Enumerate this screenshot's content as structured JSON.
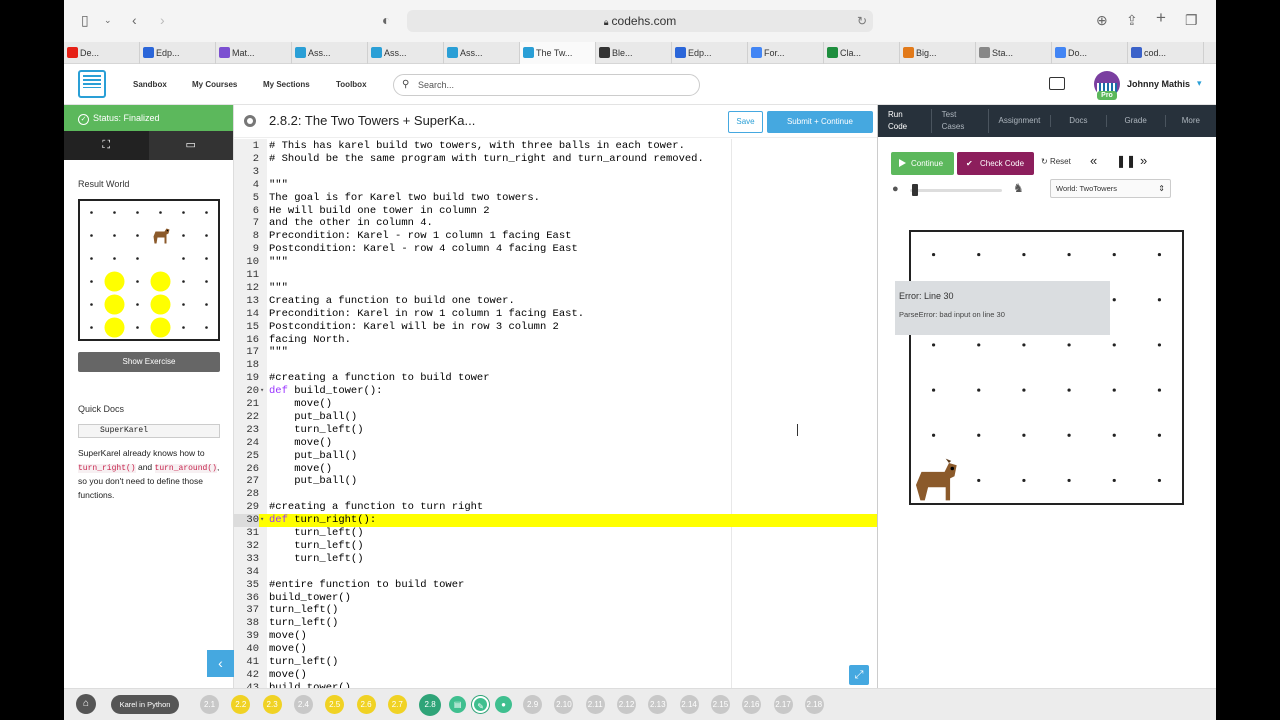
{
  "browser": {
    "url": "codehs.com",
    "tabs": [
      {
        "label": "De...",
        "color": "#e62117"
      },
      {
        "label": "Edp...",
        "color": "#2b66d9"
      },
      {
        "label": "Mat...",
        "color": "#7b4fd1"
      },
      {
        "label": "Ass...",
        "color": "#2a9fd6"
      },
      {
        "label": "Ass...",
        "color": "#2a9fd6"
      },
      {
        "label": "Ass...",
        "color": "#2a9fd6"
      },
      {
        "label": "The Tw...",
        "color": "#2a9fd6"
      },
      {
        "label": "Ble...",
        "color": "#333333"
      },
      {
        "label": "Edp...",
        "color": "#2b66d9"
      },
      {
        "label": "For...",
        "color": "#4285f4"
      },
      {
        "label": "Cla...",
        "color": "#1e8e3e"
      },
      {
        "label": "Big...",
        "color": "#e27a1a"
      },
      {
        "label": "Sta...",
        "color": "#888888"
      },
      {
        "label": "Do...",
        "color": "#4285f4"
      },
      {
        "label": "cod...",
        "color": "#3b62c9"
      }
    ],
    "active_tab": 6
  },
  "header": {
    "nav": [
      "Sandbox",
      "My Courses",
      "My Sections",
      "Toolbox"
    ],
    "search_placeholder": "Search...",
    "user_name": "Johnny Mathis",
    "badge": "Pro"
  },
  "sidebar": {
    "status": "Status: Finalized",
    "result_world_label": "Result World",
    "show_exercise": "Show Exercise",
    "quick_docs_label": "Quick Docs",
    "quick_docs_select": "SuperKarel",
    "quick_docs_text_1": "SuperKarel already knows how to ",
    "quick_docs_code_1": "turn_right()",
    "quick_docs_text_2": " and ",
    "quick_docs_code_2": "turn_around()",
    "quick_docs_text_3": ", so you don't need to define those functions."
  },
  "editor": {
    "title": "2.8.2: The Two Towers + SuperKa...",
    "save_label": "Save",
    "submit_label": "Submit + Continue",
    "highlight_line": 30,
    "lines": [
      {
        "n": "1",
        "t": "# This has karel build two towers, with three balls in each tower.",
        "c": "cm"
      },
      {
        "n": "2",
        "t": "# Should be the same program with turn_right and turn_around removed.",
        "c": "cm"
      },
      {
        "n": "3",
        "t": "",
        "c": ""
      },
      {
        "n": "4",
        "t": "\"\"\"",
        "c": "st"
      },
      {
        "n": "5",
        "t": "The goal is for Karel two build two towers.",
        "c": "st"
      },
      {
        "n": "6",
        "t": "He will build one tower in column 2",
        "c": "st"
      },
      {
        "n": "7",
        "t": "and the other in column 4.",
        "c": "st"
      },
      {
        "n": "8",
        "t": "Precondition: Karel - row 1 column 1 facing East",
        "c": "st"
      },
      {
        "n": "9",
        "t": "Postcondition: Karel - row 4 column 4 facing East",
        "c": "st"
      },
      {
        "n": "10",
        "t": "\"\"\"",
        "c": "st"
      },
      {
        "n": "11",
        "t": "",
        "c": ""
      },
      {
        "n": "12",
        "t": "\"\"\"",
        "c": "st"
      },
      {
        "n": "13",
        "t": "Creating a function to build one tower.",
        "c": "st"
      },
      {
        "n": "14",
        "t": "Precondition: Karel in row 1 column 1 facing East.",
        "c": "st"
      },
      {
        "n": "15",
        "t": "Postcondition: Karel will be in row 3 column 2",
        "c": "st"
      },
      {
        "n": "16",
        "t": "facing North.",
        "c": "st"
      },
      {
        "n": "17",
        "t": "\"\"\"",
        "c": "st"
      },
      {
        "n": "18",
        "t": "",
        "c": ""
      },
      {
        "n": "19",
        "t": "#creating a function to build tower",
        "c": "cm"
      },
      {
        "n": "20",
        "t": "def build_tower():",
        "c": "def"
      },
      {
        "n": "21",
        "t": "    move()",
        "c": ""
      },
      {
        "n": "22",
        "t": "    put_ball()",
        "c": ""
      },
      {
        "n": "23",
        "t": "    turn_left()",
        "c": ""
      },
      {
        "n": "24",
        "t": "    move()",
        "c": ""
      },
      {
        "n": "25",
        "t": "    put_ball()",
        "c": ""
      },
      {
        "n": "26",
        "t": "    move()",
        "c": ""
      },
      {
        "n": "27",
        "t": "    put_ball()",
        "c": ""
      },
      {
        "n": "28",
        "t": "",
        "c": ""
      },
      {
        "n": "29",
        "t": "#creating a function to turn right",
        "c": "cm"
      },
      {
        "n": "30",
        "t": "def turn_right():",
        "c": "def"
      },
      {
        "n": "31",
        "t": "    turn_left()",
        "c": ""
      },
      {
        "n": "32",
        "t": "    turn_left()",
        "c": ""
      },
      {
        "n": "33",
        "t": "    turn_left()",
        "c": ""
      },
      {
        "n": "34",
        "t": "",
        "c": ""
      },
      {
        "n": "35",
        "t": "#entire function to build tower",
        "c": "cm"
      },
      {
        "n": "36",
        "t": "build_tower()",
        "c": ""
      },
      {
        "n": "37",
        "t": "turn_left()",
        "c": ""
      },
      {
        "n": "38",
        "t": "turn_left()",
        "c": ""
      },
      {
        "n": "39",
        "t": "move()",
        "c": ""
      },
      {
        "n": "40",
        "t": "move()",
        "c": ""
      },
      {
        "n": "41",
        "t": "turn_left()",
        "c": ""
      },
      {
        "n": "42",
        "t": "move()",
        "c": ""
      },
      {
        "n": "43",
        "t": "build_tower()",
        "c": ""
      }
    ]
  },
  "right_panel": {
    "tabs": [
      "Run Code",
      "Test Cases",
      "Assignment",
      "Docs",
      "Grade",
      "More"
    ],
    "active_tab": 0,
    "continue_label": "Continue",
    "check_code_label": "Check Code",
    "reset_label": "Reset",
    "world_select": "World: TwoTowers",
    "error_title": "Error: Line 30",
    "error_message": "ParseError: bad input on line 30"
  },
  "bottom": {
    "course_label": "Karel in Python",
    "lessons_before": [
      {
        "label": "2.1",
        "state": "todo"
      },
      {
        "label": "2.2",
        "state": "done"
      },
      {
        "label": "2.3",
        "state": "done"
      },
      {
        "label": "2.4",
        "state": "todo"
      },
      {
        "label": "2.5",
        "state": "done"
      },
      {
        "label": "2.6",
        "state": "done"
      },
      {
        "label": "2.7",
        "state": "done"
      }
    ],
    "current_lesson": "2.8",
    "lessons_after": [
      "2.9",
      "2.10",
      "2.11",
      "2.12",
      "2.13",
      "2.14",
      "2.15",
      "2.16",
      "2.17",
      "2.18"
    ]
  },
  "colors": {
    "accent": "#45a8e0",
    "success": "#5cb85c",
    "check_code": "#8c1e5c",
    "highlight": "#ffff00",
    "ball": "#ffff00"
  }
}
